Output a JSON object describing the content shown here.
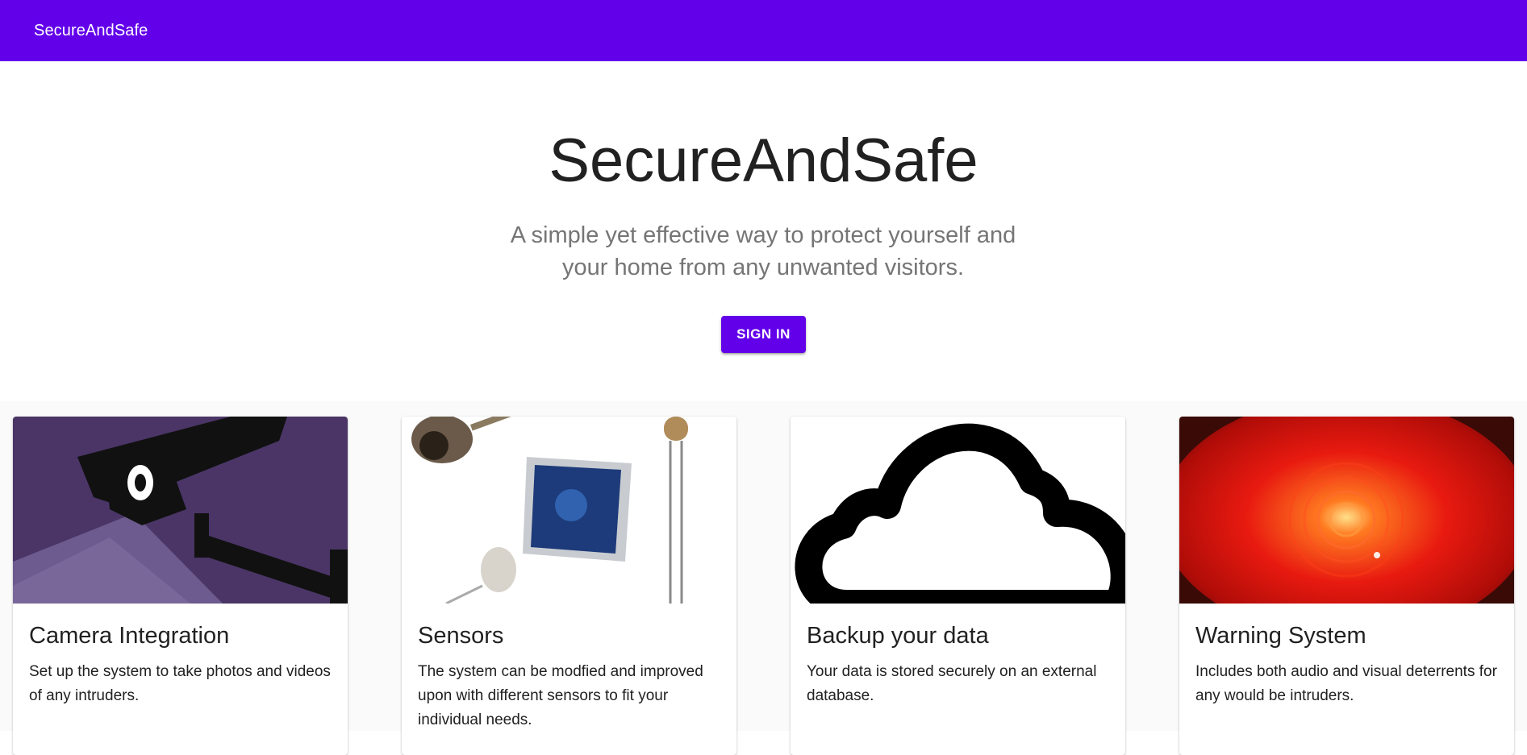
{
  "appbar": {
    "title": "SecureAndSafe"
  },
  "hero": {
    "title": "SecureAndSafe",
    "subtitle_line1": "A simple yet effective way to protect yourself and",
    "subtitle_line2": "your home from any unwanted visitors.",
    "signin_label": "SIGN IN"
  },
  "cards": [
    {
      "title": "Camera Integration",
      "text": "Set up the system to take photos and videos of any intruders.",
      "image": "security-camera-icon"
    },
    {
      "title": "Sensors",
      "text": "The system can be modfied and improved upon with different sensors to fit your individual needs.",
      "image": "sensors-photo"
    },
    {
      "title": "Backup your data",
      "text": "Your data is stored securely on an external database.",
      "image": "cloud-icon"
    },
    {
      "title": "Warning System",
      "text": "Includes both audio and visual deterrents for any would be intruders.",
      "image": "red-warning-light-photo"
    }
  ],
  "colors": {
    "primary": "#6200ea",
    "background": "#fafafa",
    "subtitle": "#757575"
  }
}
